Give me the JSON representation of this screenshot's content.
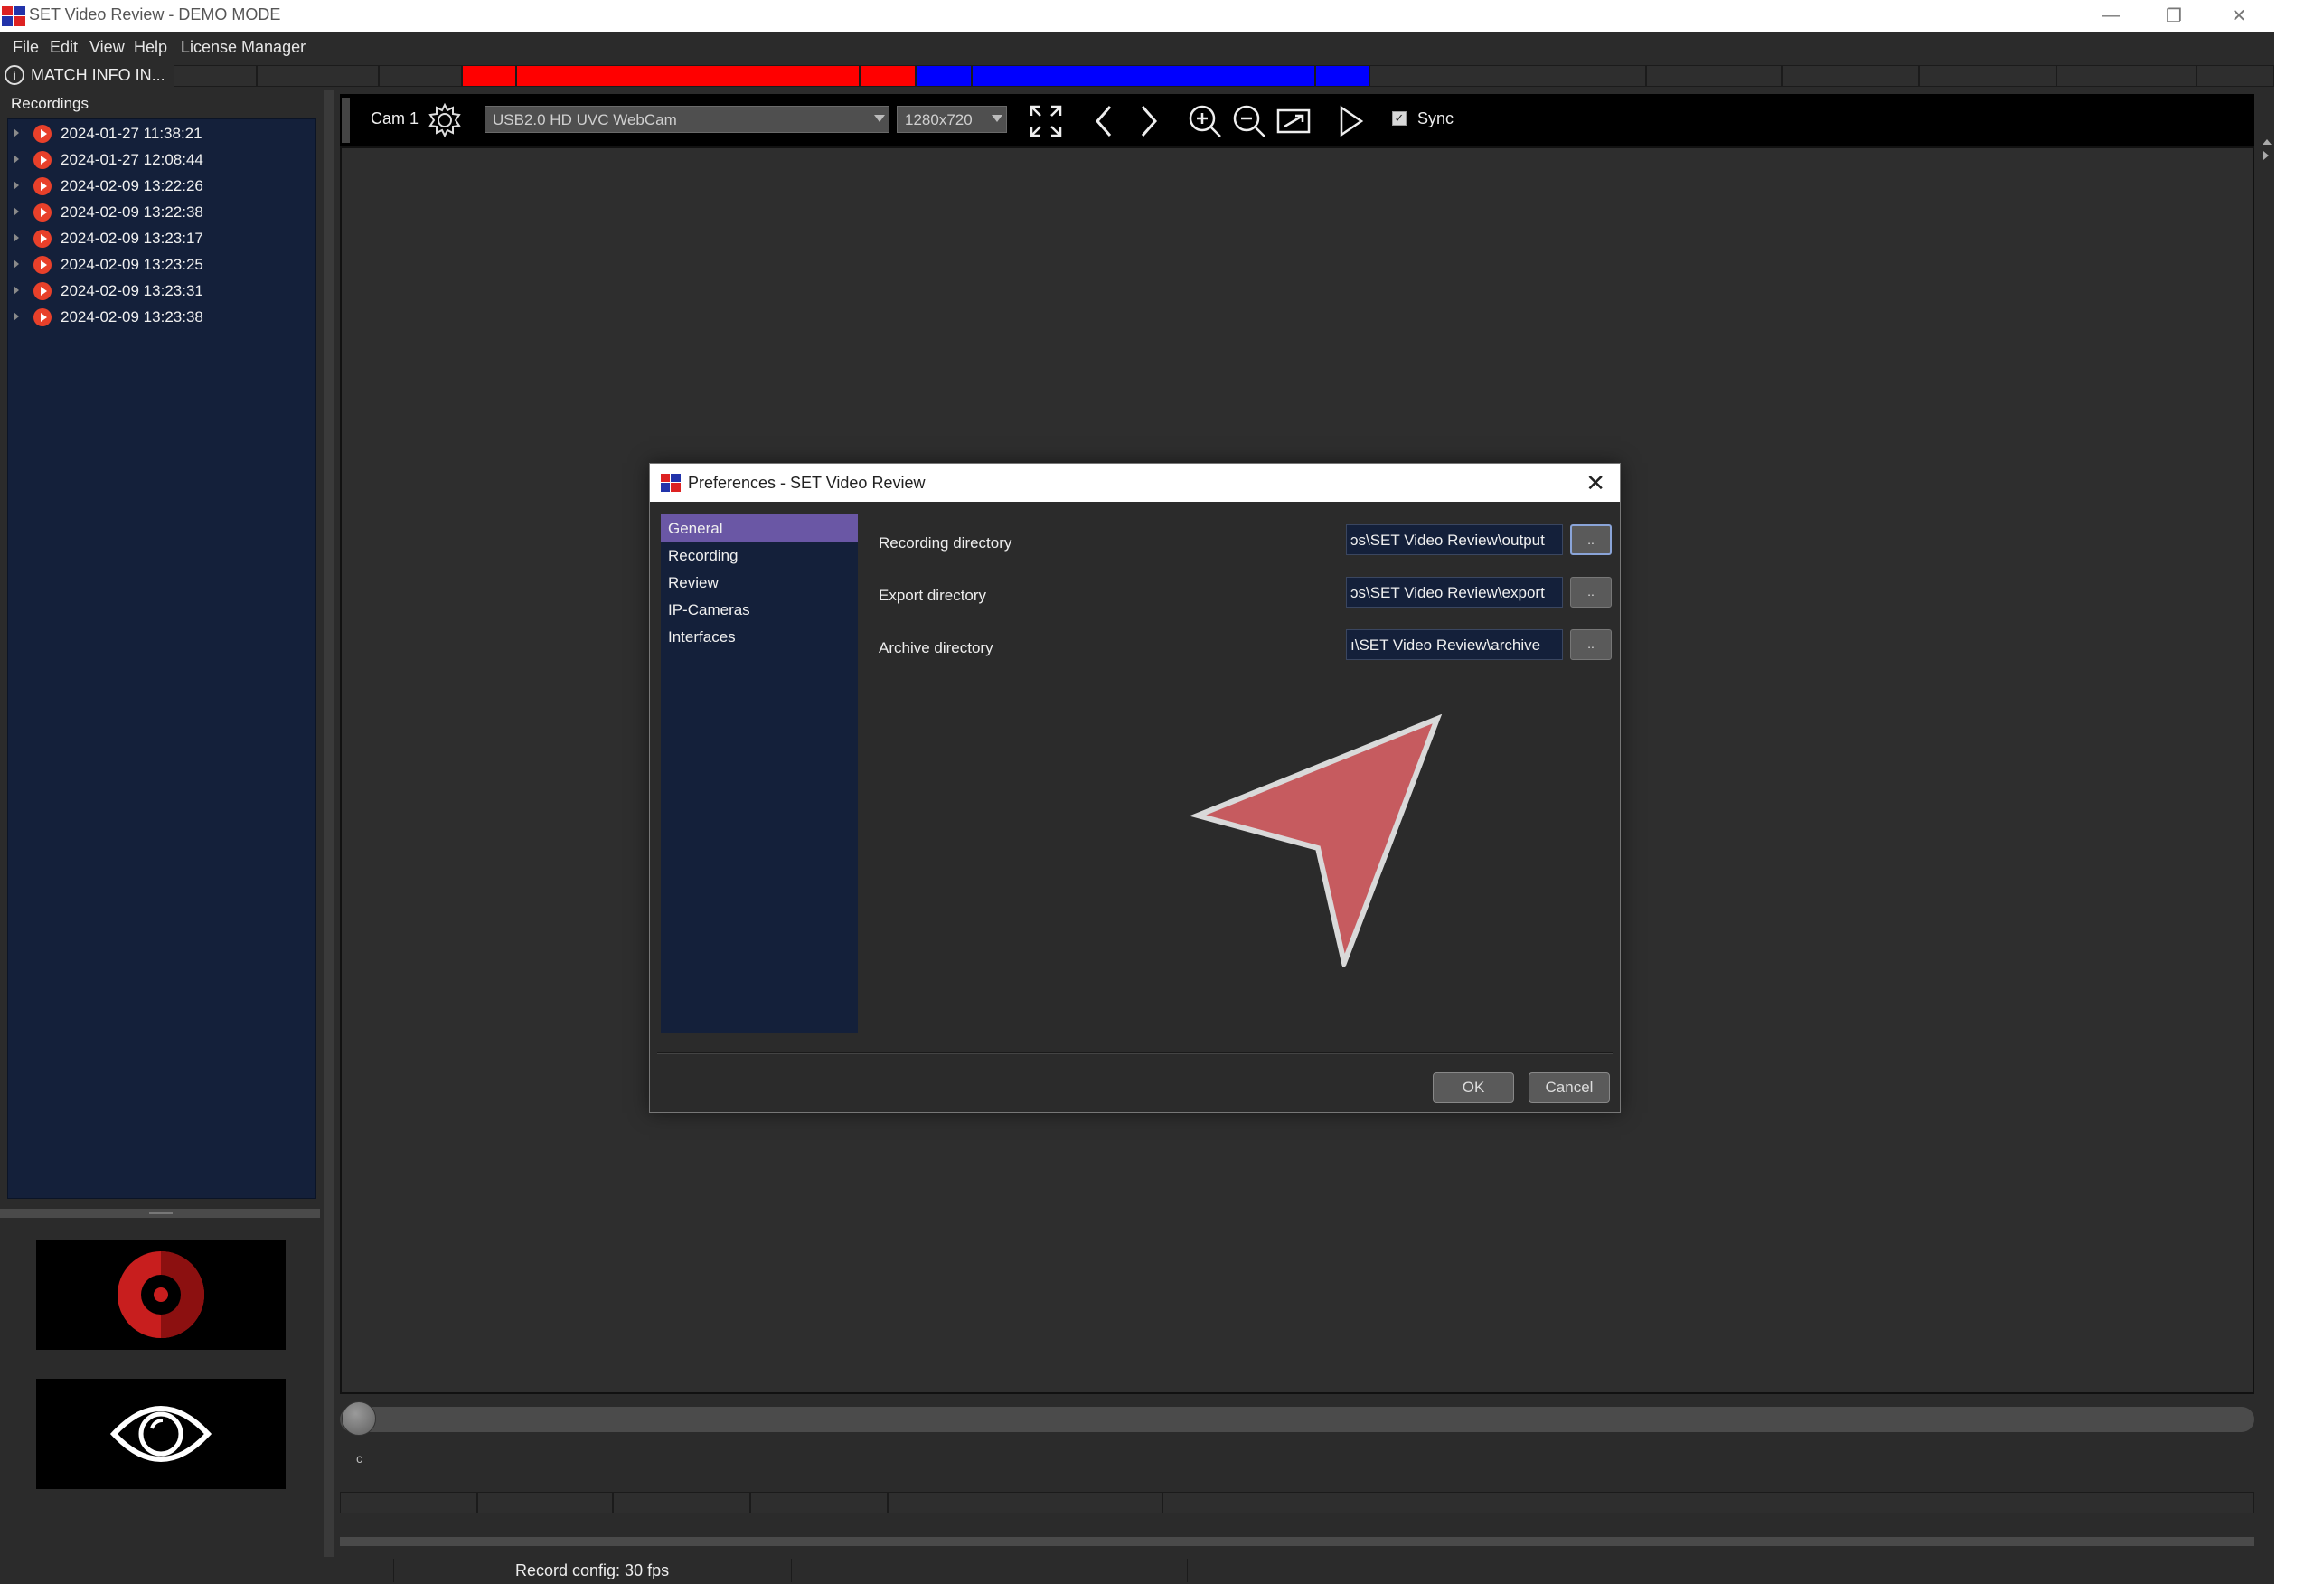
{
  "window": {
    "title": "SET Video Review - DEMO MODE",
    "controls": {
      "minimize": "—",
      "restore": "❐",
      "close": "✕"
    }
  },
  "menu": [
    "File",
    "Edit",
    "View",
    "Help",
    "License Manager"
  ],
  "match_bar": {
    "info_label": "MATCH INFO IN...",
    "red_color": "#ff0000",
    "blue_color": "#0000ff"
  },
  "recordings": {
    "header": "Recordings",
    "items": [
      "2024-01-27 11:38:21",
      "2024-01-27 12:08:44",
      "2024-02-09 13:22:26",
      "2024-02-09 13:22:38",
      "2024-02-09 13:23:17",
      "2024-02-09 13:23:25",
      "2024-02-09 13:23:31",
      "2024-02-09 13:23:38"
    ]
  },
  "camera_toolbar": {
    "cam_label": "Cam 1",
    "device": "USB2.0 HD UVC WebCam",
    "resolution": "1280x720",
    "sync_label": "Sync",
    "sync_checked": true
  },
  "timeline": {
    "position": 0,
    "tick_label": "c"
  },
  "status": {
    "text": "Record config: 30 fps"
  },
  "dialog": {
    "title": "Preferences - SET Video Review",
    "nav": [
      "General",
      "Recording",
      "Review",
      "IP-Cameras",
      "Interfaces"
    ],
    "selected_nav": "General",
    "fields": [
      {
        "label": "Recording directory",
        "value": "ɔs\\SET Video Review\\output",
        "button": ".."
      },
      {
        "label": "Export directory",
        "value": "ɔs\\SET Video Review\\export",
        "button": ".."
      },
      {
        "label": "Archive directory",
        "value": "ı\\SET Video Review\\archive",
        "button": ".."
      }
    ],
    "ok_label": "OK",
    "cancel_label": "Cancel"
  },
  "colors": {
    "accent_selection": "#6a57a5",
    "list_bg": "#14203a",
    "record_red": "#e8402a",
    "cursor_fill": "#c65b5f"
  }
}
